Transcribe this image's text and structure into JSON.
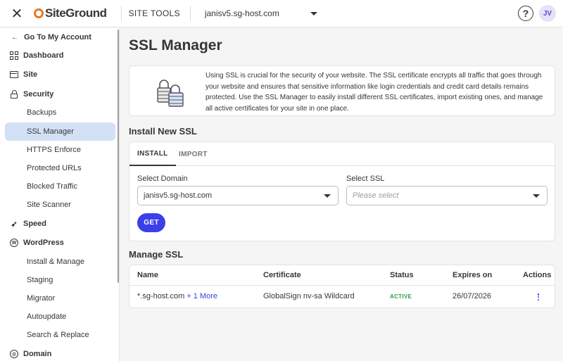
{
  "topbar": {
    "close_icon": "close-icon",
    "logo_text": "SiteGround",
    "site_tools": "SITE TOOLS",
    "site_selected": "janisv5.sg-host.com",
    "help_glyph": "?",
    "avatar_initials": "JV"
  },
  "sidebar": {
    "back": "Go To My Account",
    "items": [
      {
        "label": "Dashboard",
        "icon": "dashboard-icon"
      },
      {
        "label": "Site",
        "icon": "site-icon"
      },
      {
        "label": "Security",
        "icon": "lock-icon"
      },
      {
        "label": "Backups"
      },
      {
        "label": "SSL Manager"
      },
      {
        "label": "HTTPS Enforce"
      },
      {
        "label": "Protected URLs"
      },
      {
        "label": "Blocked Traffic"
      },
      {
        "label": "Site Scanner"
      },
      {
        "label": "Speed",
        "icon": "rocket-icon"
      },
      {
        "label": "WordPress",
        "icon": "wordpress-icon"
      },
      {
        "label": "Install & Manage"
      },
      {
        "label": "Staging"
      },
      {
        "label": "Migrator"
      },
      {
        "label": "Autoupdate"
      },
      {
        "label": "Search & Replace"
      },
      {
        "label": "Domain",
        "icon": "globe-icon"
      }
    ]
  },
  "main": {
    "title": "SSL Manager",
    "intro": "Using SSL is crucial for the security of your website. The SSL certificate encrypts all traffic that goes through your website and ensures that sensitive information like login credentials and credit card details remains protected. Use the SSL Manager to easily install different SSL certificates, import existing ones, and manage all active certificates for your site in one place.",
    "install": {
      "heading": "Install New SSL",
      "tabs": [
        "INSTALL",
        "IMPORT"
      ],
      "domain_label": "Select Domain",
      "domain_value": "janisv5.sg-host.com",
      "ssl_label": "Select SSL",
      "ssl_placeholder": "Please select",
      "get_button": "GET"
    },
    "manage": {
      "heading": "Manage SSL",
      "columns": [
        "Name",
        "Certificate",
        "Status",
        "Expires on",
        "Actions"
      ],
      "row": {
        "name": "*.sg-host.com",
        "more": "+ 1 More",
        "certificate": "GlobalSign nv-sa Wildcard",
        "status": "ACTIVE",
        "expires": "26/07/2026"
      }
    }
  },
  "colors": {
    "accent": "#3b3fe8",
    "active_nav": "#d3e1f7",
    "status_active": "#2e9e4a"
  }
}
